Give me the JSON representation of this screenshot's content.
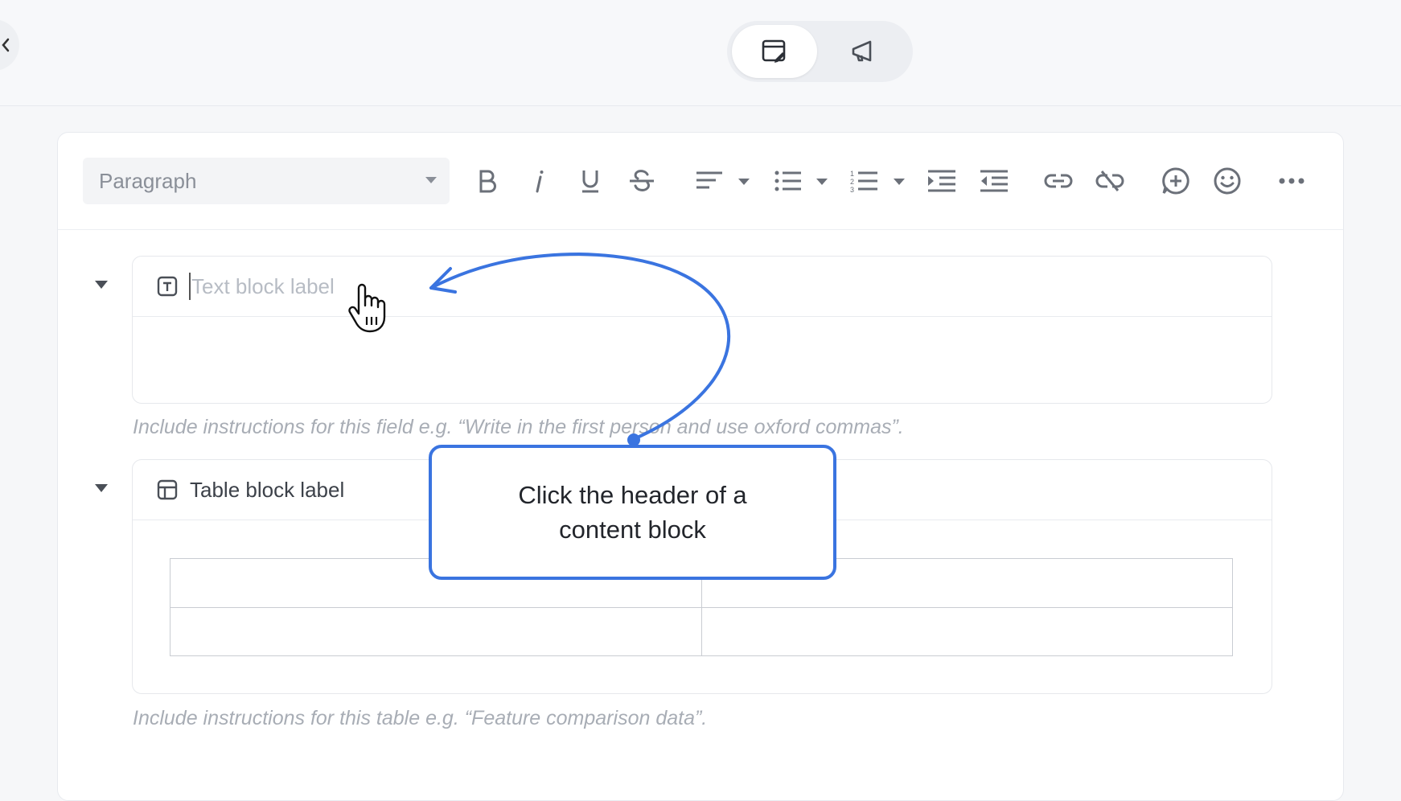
{
  "header": {
    "back_icon": "chevron-left-icon",
    "modes": [
      {
        "name": "edit-template",
        "icon": "edit-document-icon",
        "active": true
      },
      {
        "name": "announce",
        "icon": "megaphone-icon",
        "active": false
      }
    ]
  },
  "toolbar": {
    "style_select": "Paragraph",
    "buttons": [
      "bold-icon",
      "italic-icon",
      "underline-icon",
      "strikethrough-icon",
      "align-icon",
      "bullet-list-icon",
      "numbered-list-icon",
      "indent-icon",
      "outdent-icon",
      "link-icon",
      "unlink-icon",
      "add-comment-icon",
      "emoji-icon",
      "more-icon"
    ]
  },
  "blocks": [
    {
      "type": "text",
      "label_placeholder": "Text block label",
      "instruction": "Include instructions for this field e.g. “Write in the first person and use oxford commas”."
    },
    {
      "type": "table",
      "label": "Table block label",
      "rows": 2,
      "columns": 2,
      "instruction": "Include instructions for this table e.g. “Feature comparison data”."
    }
  ],
  "callout": {
    "text": "Click the header of a content block"
  },
  "colors": {
    "accent": "#3a74e0"
  }
}
